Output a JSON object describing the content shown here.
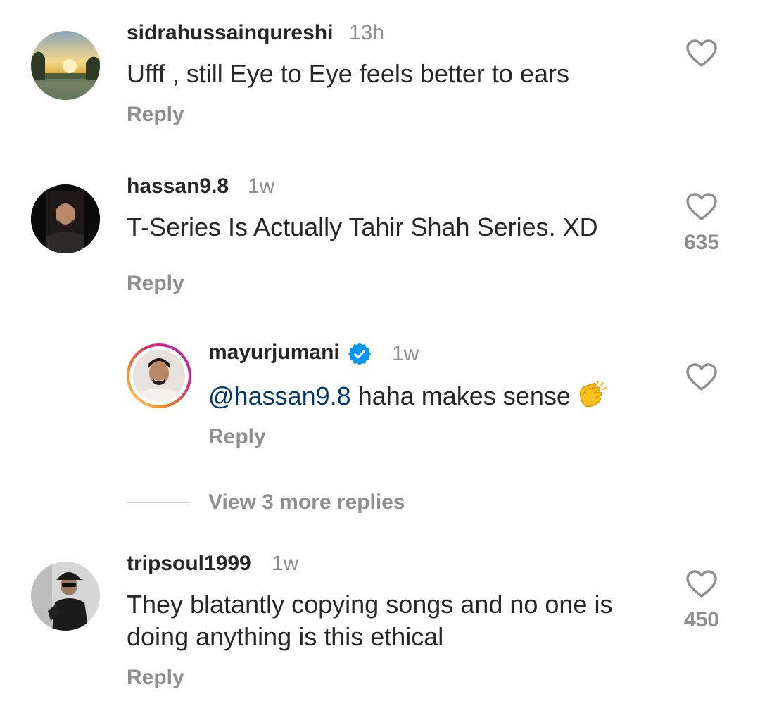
{
  "colors": {
    "text": "#262626",
    "muted": "#8e8e8e",
    "mention": "#00376b",
    "verified": "#0095f6",
    "story_ring_start": "#feda75",
    "story_ring_end": "#d62976"
  },
  "comments": [
    {
      "username": "sidrahussainqureshi",
      "time": "13h",
      "text": "Ufff , still Eye to Eye feels better to ears",
      "reply_label": "Reply",
      "like_icon": "heart-outline-icon",
      "like_count": ""
    },
    {
      "username": "hassan9.8",
      "time": "1w",
      "text": "T-Series Is Actually Tahir Shah Series. XD",
      "reply_label": "Reply",
      "like_icon": "heart-outline-icon",
      "like_count": "635"
    }
  ],
  "reply": {
    "username": "mayurjumani",
    "verified_icon": "verified-badge-icon",
    "time": "1w",
    "mention": "@hassan9.8",
    "text": " haha makes sense",
    "emoji": "clapping-hands-emoji",
    "reply_label": "Reply",
    "like_icon": "heart-outline-icon"
  },
  "view_more_replies": "View 3 more replies",
  "comment3": {
    "username": "tripsoul1999",
    "time": "1w",
    "text_line1": "They blatantly copying songs and no one is",
    "text_line2": "doing anything is this ethical",
    "reply_label": "Reply",
    "like_icon": "heart-outline-icon",
    "like_count": "450"
  }
}
